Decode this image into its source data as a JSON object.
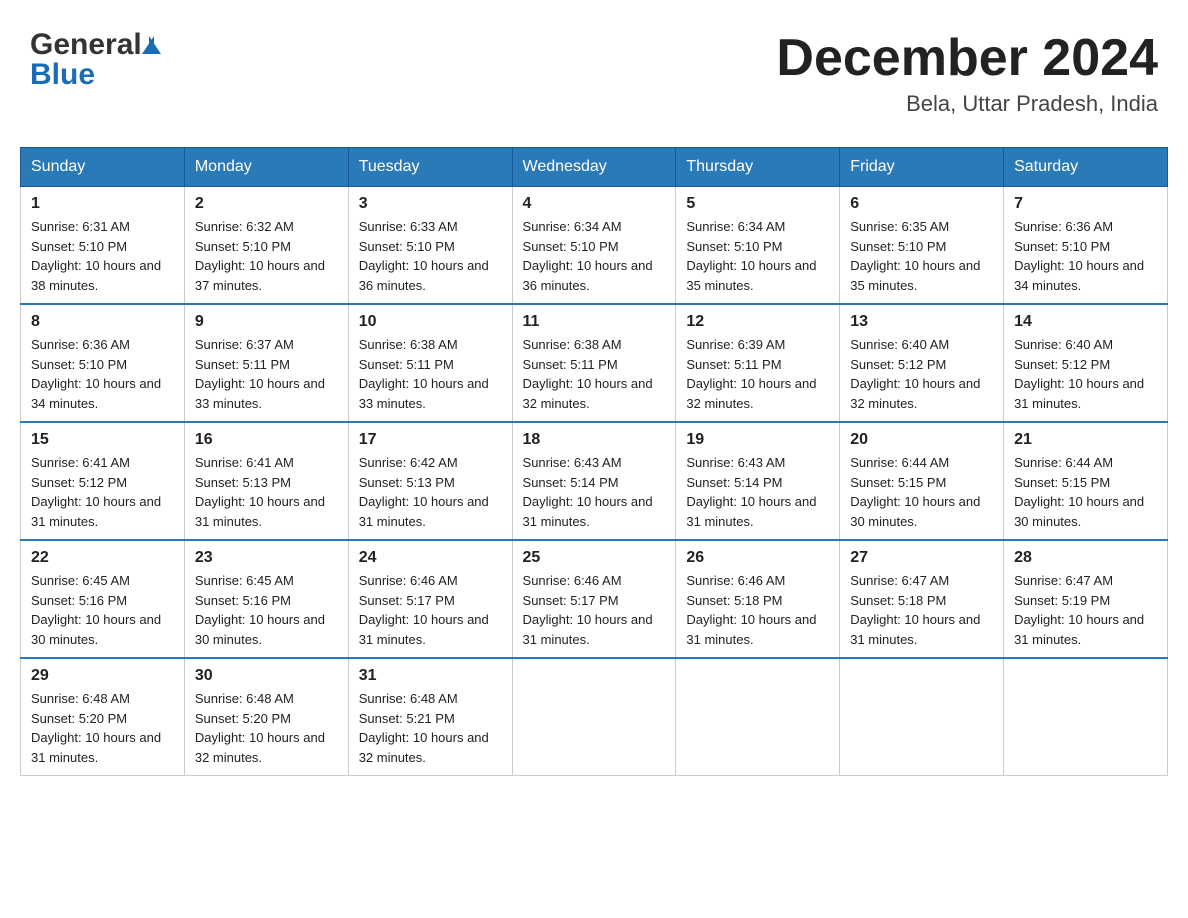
{
  "logo": {
    "line1": "General",
    "line2": "Blue"
  },
  "header": {
    "month": "December 2024",
    "location": "Bela, Uttar Pradesh, India"
  },
  "days_of_week": [
    "Sunday",
    "Monday",
    "Tuesday",
    "Wednesday",
    "Thursday",
    "Friday",
    "Saturday"
  ],
  "weeks": [
    [
      {
        "day": "1",
        "sunrise": "6:31 AM",
        "sunset": "5:10 PM",
        "daylight": "10 hours and 38 minutes."
      },
      {
        "day": "2",
        "sunrise": "6:32 AM",
        "sunset": "5:10 PM",
        "daylight": "10 hours and 37 minutes."
      },
      {
        "day": "3",
        "sunrise": "6:33 AM",
        "sunset": "5:10 PM",
        "daylight": "10 hours and 36 minutes."
      },
      {
        "day": "4",
        "sunrise": "6:34 AM",
        "sunset": "5:10 PM",
        "daylight": "10 hours and 36 minutes."
      },
      {
        "day": "5",
        "sunrise": "6:34 AM",
        "sunset": "5:10 PM",
        "daylight": "10 hours and 35 minutes."
      },
      {
        "day": "6",
        "sunrise": "6:35 AM",
        "sunset": "5:10 PM",
        "daylight": "10 hours and 35 minutes."
      },
      {
        "day": "7",
        "sunrise": "6:36 AM",
        "sunset": "5:10 PM",
        "daylight": "10 hours and 34 minutes."
      }
    ],
    [
      {
        "day": "8",
        "sunrise": "6:36 AM",
        "sunset": "5:10 PM",
        "daylight": "10 hours and 34 minutes."
      },
      {
        "day": "9",
        "sunrise": "6:37 AM",
        "sunset": "5:11 PM",
        "daylight": "10 hours and 33 minutes."
      },
      {
        "day": "10",
        "sunrise": "6:38 AM",
        "sunset": "5:11 PM",
        "daylight": "10 hours and 33 minutes."
      },
      {
        "day": "11",
        "sunrise": "6:38 AM",
        "sunset": "5:11 PM",
        "daylight": "10 hours and 32 minutes."
      },
      {
        "day": "12",
        "sunrise": "6:39 AM",
        "sunset": "5:11 PM",
        "daylight": "10 hours and 32 minutes."
      },
      {
        "day": "13",
        "sunrise": "6:40 AM",
        "sunset": "5:12 PM",
        "daylight": "10 hours and 32 minutes."
      },
      {
        "day": "14",
        "sunrise": "6:40 AM",
        "sunset": "5:12 PM",
        "daylight": "10 hours and 31 minutes."
      }
    ],
    [
      {
        "day": "15",
        "sunrise": "6:41 AM",
        "sunset": "5:12 PM",
        "daylight": "10 hours and 31 minutes."
      },
      {
        "day": "16",
        "sunrise": "6:41 AM",
        "sunset": "5:13 PM",
        "daylight": "10 hours and 31 minutes."
      },
      {
        "day": "17",
        "sunrise": "6:42 AM",
        "sunset": "5:13 PM",
        "daylight": "10 hours and 31 minutes."
      },
      {
        "day": "18",
        "sunrise": "6:43 AM",
        "sunset": "5:14 PM",
        "daylight": "10 hours and 31 minutes."
      },
      {
        "day": "19",
        "sunrise": "6:43 AM",
        "sunset": "5:14 PM",
        "daylight": "10 hours and 31 minutes."
      },
      {
        "day": "20",
        "sunrise": "6:44 AM",
        "sunset": "5:15 PM",
        "daylight": "10 hours and 30 minutes."
      },
      {
        "day": "21",
        "sunrise": "6:44 AM",
        "sunset": "5:15 PM",
        "daylight": "10 hours and 30 minutes."
      }
    ],
    [
      {
        "day": "22",
        "sunrise": "6:45 AM",
        "sunset": "5:16 PM",
        "daylight": "10 hours and 30 minutes."
      },
      {
        "day": "23",
        "sunrise": "6:45 AM",
        "sunset": "5:16 PM",
        "daylight": "10 hours and 30 minutes."
      },
      {
        "day": "24",
        "sunrise": "6:46 AM",
        "sunset": "5:17 PM",
        "daylight": "10 hours and 31 minutes."
      },
      {
        "day": "25",
        "sunrise": "6:46 AM",
        "sunset": "5:17 PM",
        "daylight": "10 hours and 31 minutes."
      },
      {
        "day": "26",
        "sunrise": "6:46 AM",
        "sunset": "5:18 PM",
        "daylight": "10 hours and 31 minutes."
      },
      {
        "day": "27",
        "sunrise": "6:47 AM",
        "sunset": "5:18 PM",
        "daylight": "10 hours and 31 minutes."
      },
      {
        "day": "28",
        "sunrise": "6:47 AM",
        "sunset": "5:19 PM",
        "daylight": "10 hours and 31 minutes."
      }
    ],
    [
      {
        "day": "29",
        "sunrise": "6:48 AM",
        "sunset": "5:20 PM",
        "daylight": "10 hours and 31 minutes."
      },
      {
        "day": "30",
        "sunrise": "6:48 AM",
        "sunset": "5:20 PM",
        "daylight": "10 hours and 32 minutes."
      },
      {
        "day": "31",
        "sunrise": "6:48 AM",
        "sunset": "5:21 PM",
        "daylight": "10 hours and 32 minutes."
      },
      null,
      null,
      null,
      null
    ]
  ],
  "labels": {
    "sunrise": "Sunrise:",
    "sunset": "Sunset:",
    "daylight": "Daylight:"
  }
}
